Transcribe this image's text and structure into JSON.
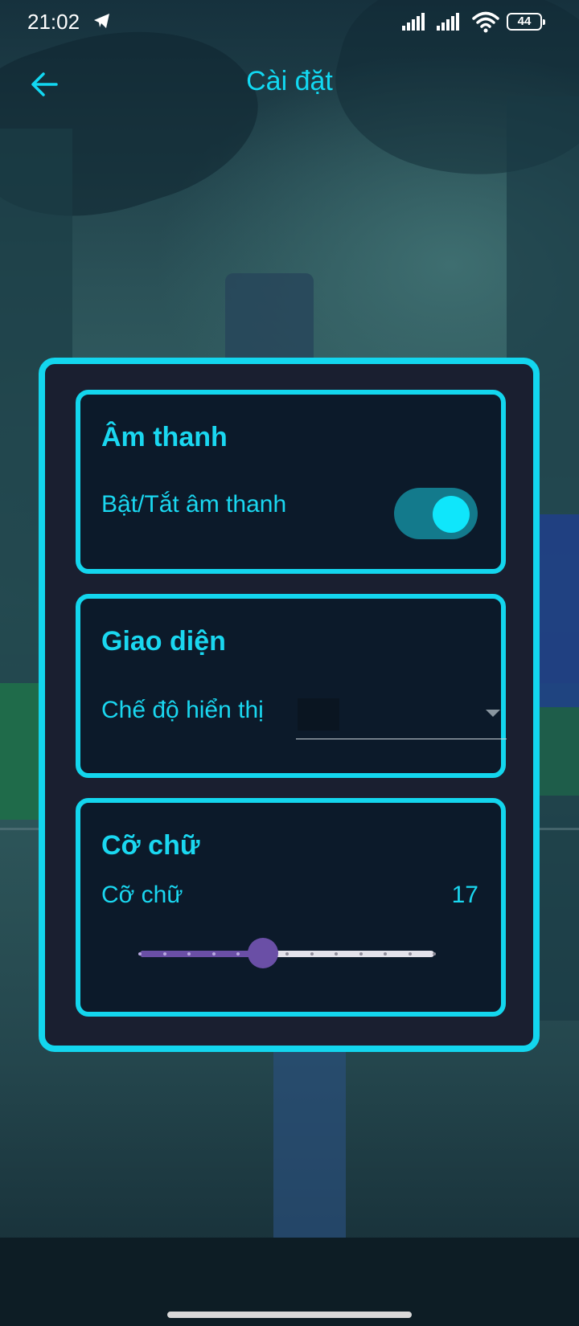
{
  "status_bar": {
    "time": "21:02",
    "battery": "44",
    "icons": [
      "telegram-icon",
      "signal-icon",
      "signal-icon",
      "wifi-icon",
      "battery-icon"
    ]
  },
  "app_bar": {
    "title": "Cài đặt",
    "back_icon": "arrow-left-icon"
  },
  "sections": {
    "sound": {
      "title": "Âm thanh",
      "toggle_label": "Bật/Tắt âm thanh",
      "toggle_on": true
    },
    "appearance": {
      "title": "Giao diện",
      "display_mode_label": "Chế độ hiển thị",
      "display_mode_value": ""
    },
    "font_size": {
      "title": "Cỡ chữ",
      "label": "Cỡ chữ",
      "value": "17",
      "slider": {
        "min": 12,
        "max": 24,
        "step": 1,
        "value": 17
      }
    }
  },
  "colors": {
    "accent": "#13d6ee",
    "card_bg": "#1a1f30",
    "section_bg": "#0c1a2a",
    "slider_active": "#6a4fa6",
    "slider_inactive": "#e4e2ea",
    "toggle_track": "#137a8c",
    "toggle_knob": "#0fe6fb"
  }
}
